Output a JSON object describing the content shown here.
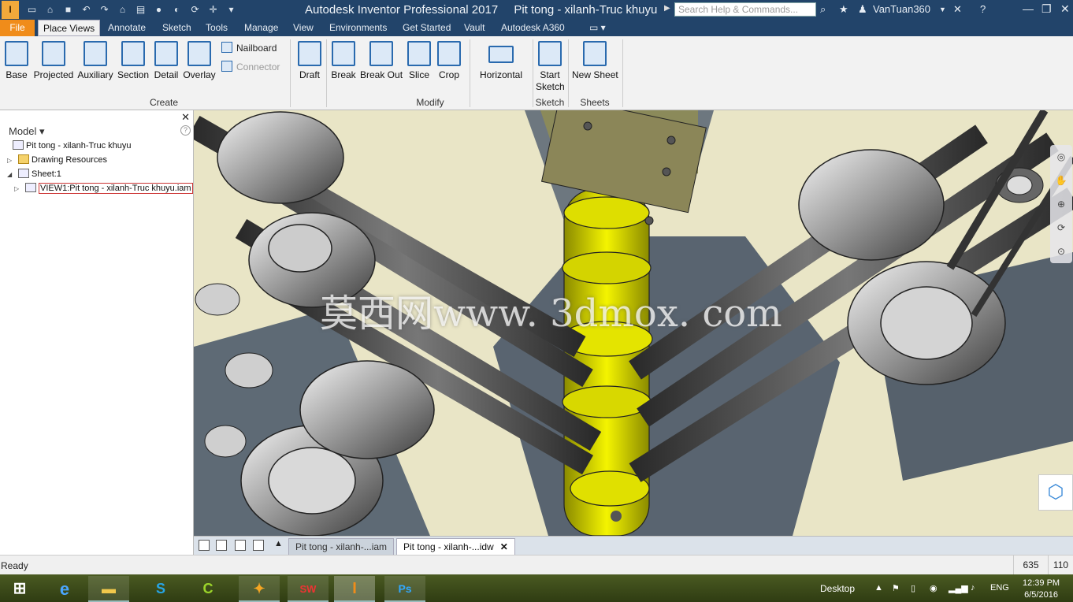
{
  "app": {
    "title": "Autodesk Inventor Professional 2017",
    "document": "Pit tong - xilanh-Truc khuyu",
    "logo_text": "I",
    "search_placeholder": "Search Help & Commands...",
    "user": "VanTuan360"
  },
  "tabs": [
    "File",
    "Place Views",
    "Annotate",
    "Sketch",
    "Tools",
    "Manage",
    "View",
    "Environments",
    "Get Started",
    "Vault",
    "Autodesk A360"
  ],
  "active_tab": "Place Views",
  "ribbon": {
    "create": {
      "label": "Create",
      "buttons": [
        "Base",
        "Projected",
        "Auxiliary",
        "Section",
        "Detail",
        "Overlay"
      ],
      "small": [
        "Nailboard",
        "Connector"
      ]
    },
    "modify": {
      "label": "Modify",
      "buttons": [
        "Draft",
        "Break",
        "Break Out",
        "Slice",
        "Crop",
        "Horizontal"
      ]
    },
    "sketch": {
      "label": "Sketch",
      "start": "Start",
      "sketch": "Sketch"
    },
    "sheets": {
      "label": "Sheets",
      "button": "New Sheet"
    }
  },
  "browser": {
    "header": "Model",
    "nodes": [
      "Pit tong - xilanh-Truc khuyu",
      "Drawing Resources",
      "Sheet:1",
      "VIEW1:Pit tong - xilanh-Truc khuyu.iam"
    ]
  },
  "watermark": "莫西网www. 3dmox. com",
  "doc_tabs": [
    "Pit tong - xilanh-...iam",
    "Pit tong - xilanh-...idw"
  ],
  "status": {
    "text": "Ready",
    "x": "635",
    "y": "110"
  },
  "taskbar": {
    "desktop": "Desktop",
    "lang": "ENG",
    "time": "12:39 PM",
    "date": "6/5/2016",
    "apps": [
      "IE",
      "Explorer",
      "Skype",
      "CCleaner",
      "Media",
      "SW 2016",
      "Inventor",
      "Ps"
    ]
  },
  "colors": {
    "titlebar": "#22446a",
    "file_tab": "#f08c1a",
    "canvas_bg": "#e9e5c6",
    "crank_yellow": "#e6e600"
  }
}
